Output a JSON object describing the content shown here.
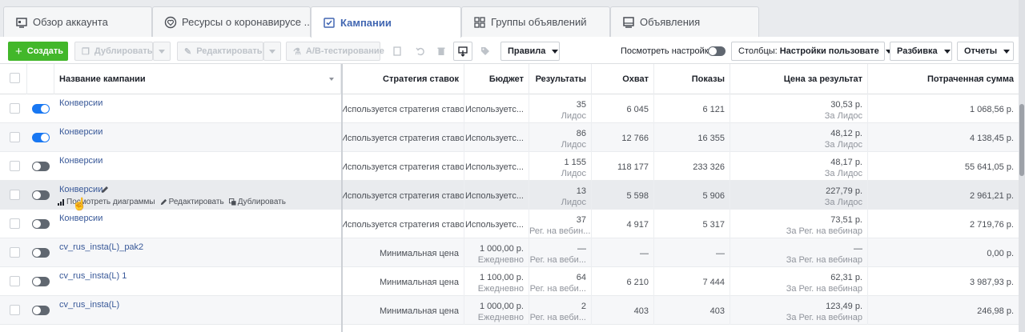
{
  "tabs": [
    {
      "label": "Обзор аккаунта",
      "icon": "account-overview-icon"
    },
    {
      "label": "Ресурсы о коронавирусе ...",
      "icon": "heart-icon"
    },
    {
      "label": "Кампании",
      "icon": "campaign-folder-icon"
    },
    {
      "label": "Группы объявлений",
      "icon": "grid-icon"
    },
    {
      "label": "Объявления",
      "icon": "ad-icon"
    }
  ],
  "toolbar": {
    "create": "Создать",
    "duplicate": "Дублировать",
    "edit": "Редактировать",
    "ab_test": "A/B-тестирование",
    "rules": "Правила",
    "view_settings": "Посмотреть настройки",
    "columns_prefix": "Столбцы:",
    "columns_value": "Настройки пользовате",
    "breakdown": "Разбивка",
    "reports": "Отчеты"
  },
  "table": {
    "headers": {
      "name": "Название кампании",
      "strategy": "Стратегия ставок",
      "budget": "Бюджет",
      "results": "Результаты",
      "reach": "Охват",
      "impressions": "Показы",
      "cost_per_result": "Цена за результат",
      "spent": "Потраченная сумма"
    },
    "hover_actions": {
      "charts": "Посмотреть диаграммы",
      "edit": "Редактировать",
      "duplicate": "Дублировать"
    },
    "rows": [
      {
        "on": true,
        "name": "Конверсии",
        "strategy": "Используется стратегия ставок ...",
        "budget": "Используетс...",
        "budget2": "",
        "results": "35",
        "results2": "Лидос",
        "reach": "6 045",
        "impressions": "6 121",
        "cpr": "30,53 р.",
        "cpr2": "За Лидос",
        "spent": "1 068,56 р."
      },
      {
        "on": true,
        "name": "Конверсии",
        "strategy": "Используется стратегия ставок ...",
        "budget": "Используетс...",
        "budget2": "",
        "results": "86",
        "results2": "Лидос",
        "reach": "12 766",
        "impressions": "16 355",
        "cpr": "48,12 р.",
        "cpr2": "За Лидос",
        "spent": "4 138,45 р."
      },
      {
        "on": false,
        "name": "Конверсии",
        "strategy": "Используется стратегия ставок ...",
        "budget": "Используетс...",
        "budget2": "",
        "results": "1 155",
        "results2": "Лидос",
        "reach": "118 177",
        "impressions": "233 326",
        "cpr": "48,17 р.",
        "cpr2": "За Лидос",
        "spent": "55 641,05 р."
      },
      {
        "on": false,
        "name": "Конверсии",
        "strategy": "Используется стратегия ставок ...",
        "budget": "Используетс...",
        "budget2": "",
        "results": "13",
        "results2": "Лидос",
        "reach": "5 598",
        "impressions": "5 906",
        "cpr": "227,79 р.",
        "cpr2": "За Лидос",
        "spent": "2 961,21 р."
      },
      {
        "on": false,
        "name": "Конверсии",
        "strategy": "Используется стратегия ставок ...",
        "budget": "Используетс...",
        "budget2": "",
        "results": "37",
        "results2": "Рег. на вебин...",
        "reach": "4 917",
        "impressions": "5 317",
        "cpr": "73,51 р.",
        "cpr2": "За Рег. на вебинар",
        "spent": "2 719,76 р."
      },
      {
        "on": false,
        "name": "cv_rus_insta(L)_pak2",
        "strategy": "Минимальная цена",
        "budget": "1 000,00 р.",
        "budget2": "Ежедневно",
        "results": "—",
        "results2": "Рег. на веби...",
        "reach": "—",
        "impressions": "—",
        "cpr": "—",
        "cpr2": "За Рег. на вебинар",
        "spent": "0,00 р."
      },
      {
        "on": false,
        "name": "cv_rus_insta(L) 1",
        "strategy": "Минимальная цена",
        "budget": "1 100,00 р.",
        "budget2": "Ежедневно",
        "results": "64",
        "results2": "Рег. на веби...",
        "reach": "6 210",
        "impressions": "7 444",
        "cpr": "62,31 р.",
        "cpr2": "За Рег. на вебинар",
        "spent": "3 987,93 р."
      },
      {
        "on": false,
        "name": "cv_rus_insta(L)",
        "strategy": "Минимальная цена",
        "budget": "1 000,00 р.",
        "budget2": "Ежедневно",
        "results": "2",
        "results2": "Рег. на веби...",
        "reach": "403",
        "impressions": "403",
        "cpr": "123,49 р.",
        "cpr2": "За Рег. на вебинар",
        "spent": "246,98 р."
      }
    ]
  },
  "colors": {
    "accent": "#4267b2",
    "create": "#42b72a",
    "toggle_on": "#1877f2"
  }
}
